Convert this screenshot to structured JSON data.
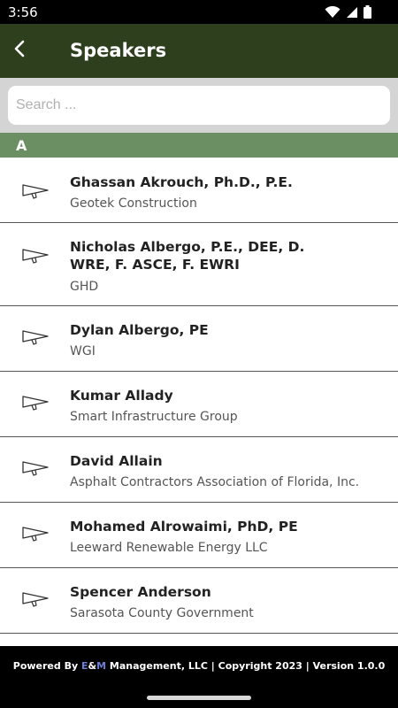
{
  "status_bar": {
    "time": "3:56",
    "icons": [
      "wifi-icon",
      "signal-icon",
      "battery-icon"
    ]
  },
  "app_bar": {
    "title": "Speakers",
    "back_icon": "back-arrow-icon"
  },
  "search": {
    "placeholder": "Search ..."
  },
  "section": {
    "letter": "A"
  },
  "speakers": [
    {
      "name": "Ghassan Akrouch, Ph.D., P.E.",
      "org": "Geotek Construction"
    },
    {
      "name": "Nicholas Albergo, P.E., DEE, D. WRE, F. ASCE, F. EWRI",
      "org": "GHD"
    },
    {
      "name": "Dylan Albergo, PE",
      "org": "WGI"
    },
    {
      "name": "Kumar Allady",
      "org": "Smart Infrastructure Group"
    },
    {
      "name": "David Allain",
      "org": "Asphalt Contractors Association of Florida, Inc."
    },
    {
      "name": "Mohamed Alrowaimi, PhD, PE",
      "org": "Leeward Renewable Energy LLC"
    },
    {
      "name": "Spencer Anderson",
      "org": "Sarasota County Government"
    }
  ],
  "footer": {
    "prefix": "Powered By ",
    "brand_e": "E",
    "brand_amp": "&",
    "brand_m": "M",
    "suffix": " Management, LLC | Copyright 2023 | Version 1.0.0"
  },
  "colors": {
    "app_bar": "#2e3f1e",
    "section_header": "#6b8f63",
    "footer_brand": "#6b7fd6"
  }
}
